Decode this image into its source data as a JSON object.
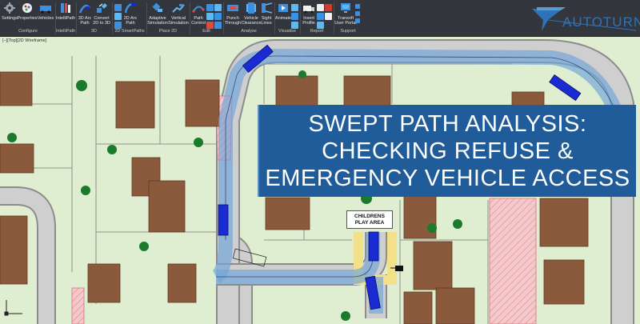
{
  "ribbon": {
    "groups": [
      {
        "label": "Configure",
        "buttons": [
          {
            "id": "settings",
            "label": "Settings",
            "icon": "settings-icon"
          },
          {
            "id": "properties",
            "label": "Properties",
            "icon": "properties-icon"
          },
          {
            "id": "vehicles",
            "label": "Vehicles",
            "icon": "vehicles-icon"
          }
        ]
      },
      {
        "label": "IntelliPath",
        "buttons": [
          {
            "id": "intellipath",
            "label": "IntelliPath",
            "icon": "intellipath-icon"
          }
        ]
      },
      {
        "label": "3D",
        "buttons": [
          {
            "id": "arc3d",
            "label": "3D Arc\nPath",
            "icon": "3d-arc-path-icon"
          },
          {
            "id": "convert",
            "label": "Convert\n2D to 3D",
            "icon": "convert-icon"
          }
        ]
      },
      {
        "label": "2D SmartPaths",
        "buttons": [
          {
            "id": "arc2d",
            "label": "2D Arc\nPath",
            "icon": "2d-arc-path-icon"
          }
        ]
      },
      {
        "label": "Place 2D",
        "buttons": [
          {
            "id": "adaptive",
            "label": "Adaptive\nSimulation",
            "icon": "adaptive-simulation-icon"
          },
          {
            "id": "vertical",
            "label": "Vertical\nSimulation",
            "icon": "vertical-simulation-icon"
          }
        ]
      },
      {
        "label": "Edit",
        "buttons": [
          {
            "id": "pathcontrol",
            "label": "Path\nControl",
            "icon": "path-control-icon"
          }
        ]
      },
      {
        "label": "Analyse",
        "buttons": [
          {
            "id": "punch",
            "label": "Punch\nThrough",
            "icon": "punch-through-icon"
          },
          {
            "id": "clearance",
            "label": "Vehicle\nClearance",
            "icon": "vehicle-clearance-icon"
          },
          {
            "id": "sight",
            "label": "Sight\nLines",
            "icon": "sight-lines-icon"
          }
        ]
      },
      {
        "label": "Visualise",
        "buttons": [
          {
            "id": "animate",
            "label": "Animate",
            "icon": "animate-icon"
          }
        ]
      },
      {
        "label": "Report",
        "buttons": [
          {
            "id": "insertprofile",
            "label": "Insert\nProfile",
            "icon": "insert-profile-icon"
          }
        ]
      },
      {
        "label": "Support",
        "buttons": [
          {
            "id": "transoft",
            "label": "Transoft\nUser Portal",
            "icon": "user-portal-icon"
          }
        ]
      }
    ]
  },
  "logo": {
    "text": "AUTOTURN",
    "color": "#2e73b8"
  },
  "viewport": {
    "label": "[−][Top][2D Wireframe]"
  },
  "banner": {
    "lines": [
      "SWEPT PATH ANALYSIS:",
      "CHECKING REFUSE &",
      "EMERGENCY VEHICLE ACCESS"
    ],
    "background": "#1f5c99"
  },
  "play_area": {
    "line1": "CHILDRENS",
    "line2": "PLAY AREA"
  },
  "colors": {
    "grass": "#dfeed0",
    "road": "#c9c9c9",
    "house": "#8b5a3c",
    "tree": "#1b7a2c",
    "swept_path": "#6fa3d8",
    "vehicle": "#1a2bd4",
    "hatch": "#e89aa0"
  }
}
